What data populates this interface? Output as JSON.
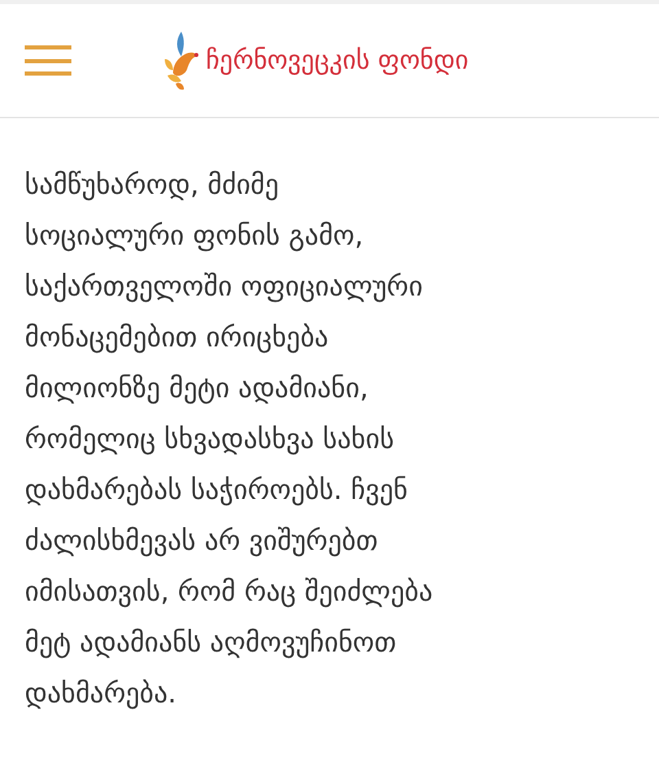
{
  "header": {
    "logo_text": "ჩერნოვეცკის ფონდი"
  },
  "article": {
    "lines": [
      "სამწუხაროდ, მძიმე",
      "სოციალური ფონის გამო,",
      "საქართველოში ოფიციალური",
      "მონაცემებით ირიცხება",
      "მილიონზე მეტი ადამიანი,",
      "რომელიც სხვადასხვა სახის",
      "დახმარებას საჭიროებს. ჩვენ",
      "ძალისხმევას არ ვიშურებთ",
      "იმისათვის, რომ რაც შეიძლება",
      "მეტ ადამიანს აღმოვუჩინოთ",
      "დახმარება."
    ]
  }
}
